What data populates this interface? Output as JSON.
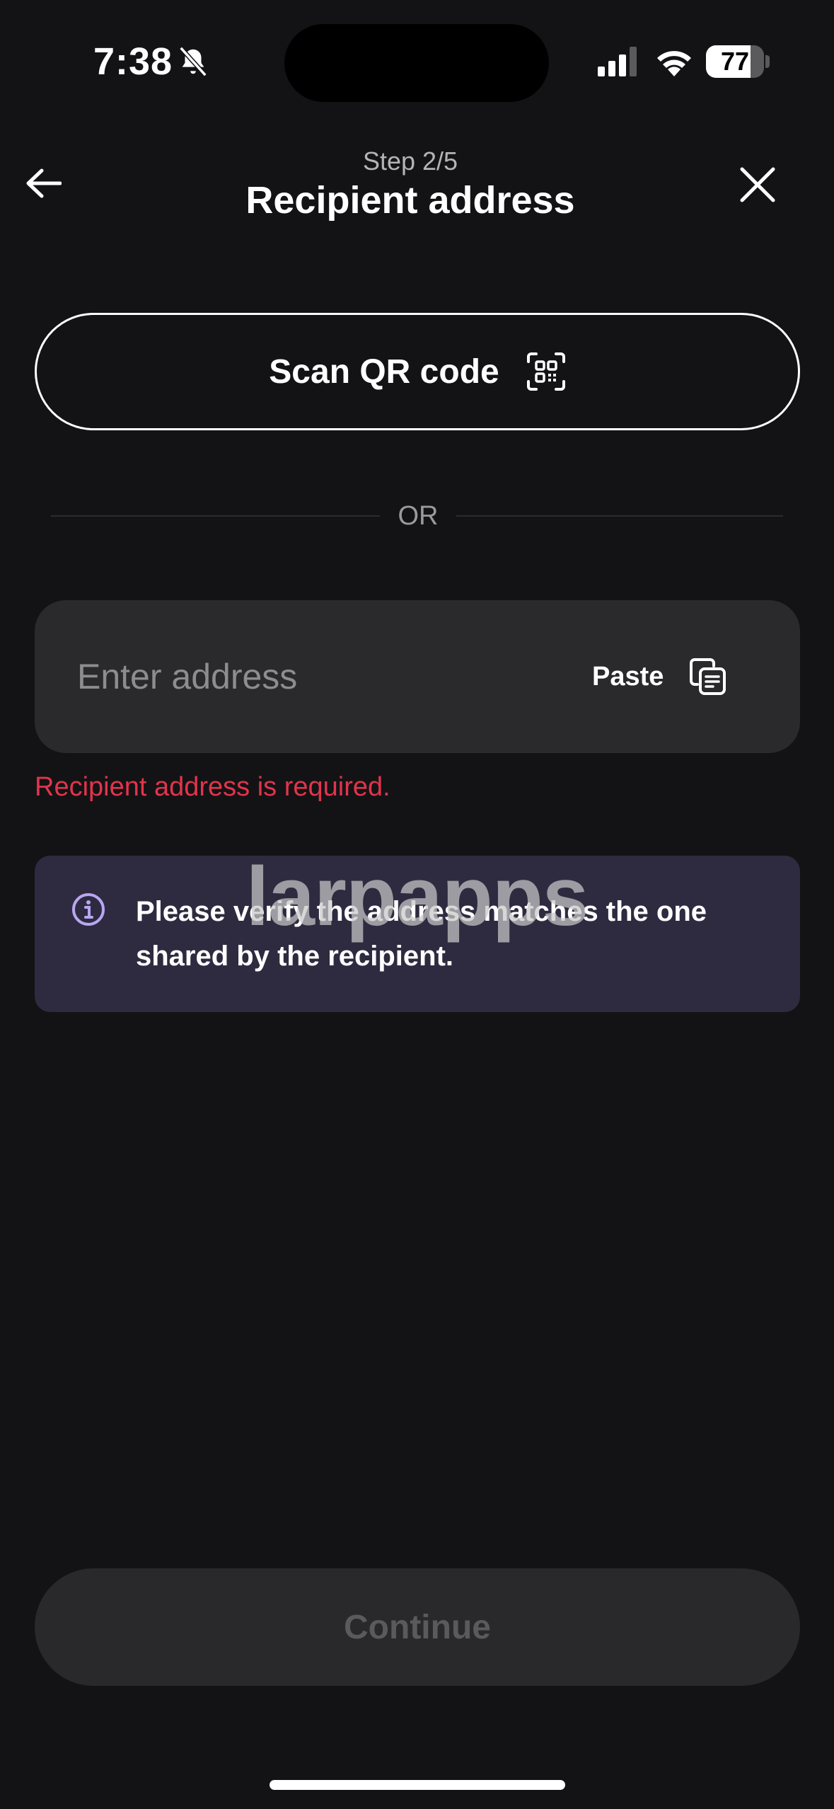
{
  "status_bar": {
    "time": "7:38",
    "battery_level": "77",
    "icons": [
      "bell-slash-icon",
      "cellular-signal-icon",
      "wifi-icon",
      "battery-icon"
    ]
  },
  "header": {
    "step": "Step 2/5",
    "title": "Recipient address",
    "icons": [
      "arrow-left-icon",
      "close-icon"
    ]
  },
  "scan": {
    "label": "Scan QR code",
    "icon": "qr-scan-icon"
  },
  "divider": {
    "label": "OR"
  },
  "address": {
    "placeholder": "Enter address",
    "value": "",
    "paste_label": "Paste",
    "paste_icon": "clipboard-icon",
    "error": "Recipient address is required."
  },
  "info": {
    "icon": "info-icon",
    "text": "Please verify the address matches the one shared by the recipient."
  },
  "watermark": "larpapps",
  "footer": {
    "continue_label": "Continue",
    "continue_disabled": true
  },
  "colors": {
    "background": "#131315",
    "field": "#2a2a2c",
    "error": "#e2344c",
    "info_banner": "#2e2b40",
    "info_accent": "#b9a6f0",
    "disabled_text": "#5a5a5e"
  }
}
